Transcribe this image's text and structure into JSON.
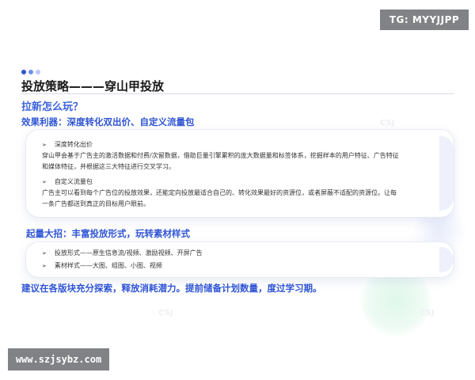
{
  "badges": {
    "telegram": "TG: MYYJJPP",
    "site": "www.szjsybz.com"
  },
  "slide": {
    "title": "投放策略———穿山甲投放",
    "subtitle": "拉新怎么玩？",
    "section1": {
      "heading": "效果利器：深度转化双出价、自定义流量包",
      "items": [
        {
          "label": "深度转化出价",
          "lines": [
            "穿山甲会基于广告主的激活数据和付费/次留数据，借助巨量引擎累积的庞大数据量和标签体系，挖掘样本的用户特征、广告特征",
            "和媒体特征，并根据这三大特征进行交叉学习。"
          ]
        },
        {
          "label": "自定义流量包",
          "lines": [
            "广告主可以看到每个广告位的投放效果，还能定向投放最适合自己的、转化效果最好的资源位，或者屏蔽不适配的资源位。让每",
            "一条广告都送到真正的目标用户眼前。"
          ]
        }
      ]
    },
    "section2": {
      "heading": "起量大招：丰富投放形式，玩转素材样式",
      "items": [
        "投放形式——原生信息流/视频、激励视频、开屏广告",
        "素材样式——大图、组图、小图、视频"
      ]
    },
    "conclusion": "建议在各版块充分探索，释放消耗潜力。提前储备计划数量，度过学习期。"
  },
  "colors": {
    "accent_blue": "#2f55d4",
    "subtitle_blue": "#3d63dd",
    "dot_dark": "#2f55d4",
    "dot_mid": "#6f8ef0",
    "dot_light": "#b9c8f8",
    "badge_gray": "#808285",
    "deco_green": "#d9f5e6"
  },
  "icons": {
    "bullet": "arrow-right-icon",
    "title_dots": "dots-icon"
  }
}
